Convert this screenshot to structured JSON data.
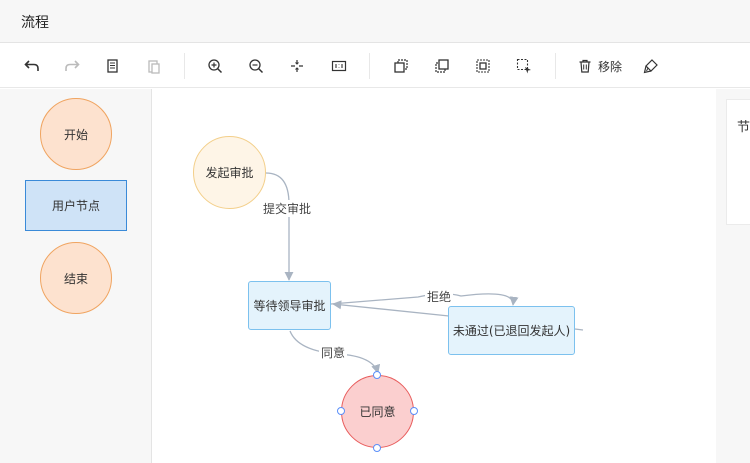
{
  "app": {
    "title": "流程"
  },
  "toolbar": {
    "remove_label": "移除",
    "icons": [
      "undo-icon",
      "redo-icon",
      "copy-icon",
      "paste-icon",
      "zoom-in-icon",
      "zoom-out-icon",
      "fit-view-icon",
      "actual-size-icon",
      "to-back-icon",
      "to-front-icon",
      "multi-select-icon",
      "marquee-select-icon",
      "trash-icon",
      "format-brush-icon"
    ]
  },
  "palette": {
    "items": [
      {
        "label": "开始",
        "shape": "circle"
      },
      {
        "label": "用户节点",
        "shape": "rect"
      },
      {
        "label": "结束",
        "shape": "circle"
      }
    ]
  },
  "canvas": {
    "nodes": [
      {
        "label": "发起审批",
        "shape": "circle"
      },
      {
        "label": "等待领导审批",
        "shape": "rect"
      },
      {
        "label": "未通过(已退回发起人)",
        "shape": "rect"
      },
      {
        "label": "已同意",
        "shape": "circle",
        "selected": true
      }
    ],
    "edges": [
      {
        "label": "提交审批"
      },
      {
        "label": "拒绝"
      },
      {
        "label": "同意"
      }
    ]
  },
  "properties": {
    "label": "节"
  },
  "colors": {
    "start_fill": "#fde2cf",
    "start_stroke": "#f0a460",
    "task_fill": "#e4f3fc",
    "task_stroke": "#7cc1ee",
    "end_selected_fill": "#fbcfcf",
    "end_selected_stroke": "#e85c5c",
    "edge": "#a9b4c2",
    "handle": "#5b8ff9"
  }
}
